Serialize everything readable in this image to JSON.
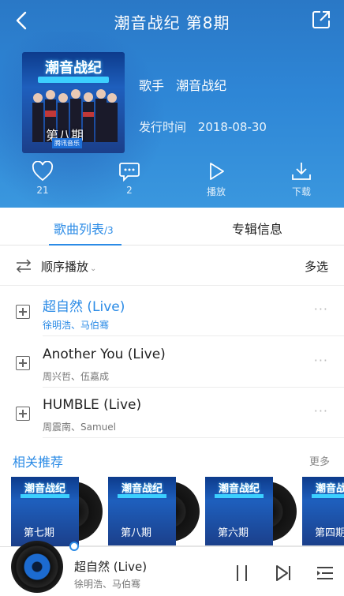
{
  "header": {
    "title": "潮音战纪 第8期",
    "cover_logo": "潮音战纪",
    "cover_episode": "第八期",
    "cover_brand": "腾讯音乐",
    "singer_label": "歌手",
    "singer": "潮音战纪",
    "date_label": "发行时间",
    "date": "2018-08-30"
  },
  "actions": {
    "like_count": "21",
    "comment_count": "2",
    "play_label": "播放",
    "download_label": "下载"
  },
  "tabs": {
    "songs_label": "歌曲列表",
    "songs_count": "/3",
    "info_label": "专辑信息"
  },
  "playbar": {
    "order_label": "顺序播放",
    "chevron": "⌄",
    "multi_select": "多选"
  },
  "songs": [
    {
      "name": "超自然 (Live)",
      "artist": "徐明浩、马伯骞"
    },
    {
      "name": "Another You (Live)",
      "artist": "周兴哲、伍嘉成"
    },
    {
      "name": "HUMBLE (Live)",
      "artist": "周震南、Samuel"
    }
  ],
  "more_glyph": "···",
  "recommend": {
    "title": "相关推荐",
    "more": "更多",
    "items": [
      {
        "logo": "潮音战纪",
        "episode": "第七期"
      },
      {
        "logo": "潮音战纪",
        "episode": "第八期"
      },
      {
        "logo": "潮音战纪",
        "episode": "第六期"
      },
      {
        "logo": "潮音战纪",
        "episode": "第四期"
      }
    ]
  },
  "player": {
    "title": "超自然 (Live)",
    "artist": "徐明浩、马伯骞",
    "progress": 0.0
  },
  "colors": {
    "accent": "#2b8be6",
    "hero_top": "#2a78c6",
    "hero_bottom": "#3a97de"
  }
}
